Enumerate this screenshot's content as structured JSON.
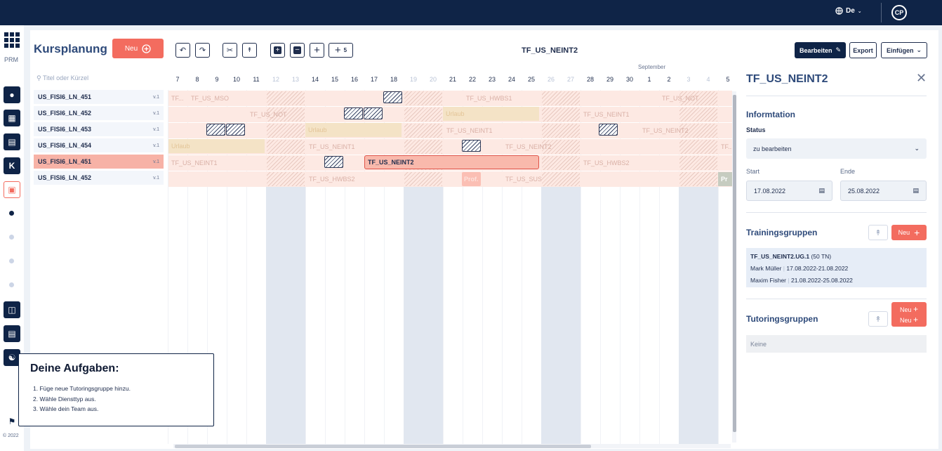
{
  "header": {
    "lang": "De",
    "avatar": "CP"
  },
  "rail": {
    "label": "PRM",
    "k": "K",
    "copyright": "© 2022"
  },
  "page": {
    "title": "Kursplanung",
    "new_button": "Neu",
    "search_placeholder": "Titel oder Kürzel"
  },
  "courses": [
    {
      "name": "US_FISI6_LN_451",
      "version": "v.1"
    },
    {
      "name": "US_FISI6_LN_452",
      "version": "v.1"
    },
    {
      "name": "US_FISI6_LN_453",
      "version": "v.1"
    },
    {
      "name": "US_FISI6_LN_454",
      "version": "v.1"
    },
    {
      "name": "US_FISI6_LN_451",
      "version": "v.1"
    },
    {
      "name": "US_FISI6_LN_452",
      "version": "v.1"
    }
  ],
  "toolbar": {
    "title": "TF_US_NEINT2",
    "zoom_count": "5",
    "edit": "Bearbeiten",
    "export": "Export",
    "insert": "Einfügen"
  },
  "calendar": {
    "month": "September",
    "days": [
      "7",
      "8",
      "9",
      "10",
      "11",
      "12",
      "13",
      "14",
      "15",
      "16",
      "17",
      "18",
      "19",
      "20",
      "21",
      "22",
      "23",
      "24",
      "25",
      "26",
      "27",
      "28",
      "29",
      "30",
      "1",
      "2",
      "3",
      "4",
      "5"
    ],
    "weekend_indices": [
      5,
      6,
      12,
      13,
      19,
      20,
      26,
      27
    ],
    "labels": {
      "r0a": "TF...",
      "r0b": "TF_US_MSO",
      "r0c": "TF_US_HWBS1",
      "r0d": "TF_US_NOT",
      "r1a": "TF_US_NOT",
      "r1b": "Urlaub",
      "r1c": "TF_US_NEINT1",
      "r2a": "Urlaub",
      "r2b": "TF_US_NEINT1",
      "r2c": "TF_US_NEINT2",
      "r3a": "Urlaub",
      "r3b": "TF_US_NEINT1",
      "r3c": "TF_US_NEINT2",
      "r3d": "TF...",
      "r4a": "TF_US_NEINT1",
      "r4b": "TF_US_NEINT2",
      "r4c": "TF_US_HWBS2",
      "r5a": "TF_US_HWBS2",
      "r5b": "Prof.",
      "r5c": "TF_US_SUS",
      "r5d": "Pr"
    }
  },
  "side": {
    "title": "TF_US_NEINT2",
    "info_heading": "Informtation",
    "status_label": "Status",
    "status_value": "zu bearbeiten",
    "start_label": "Start",
    "end_label": "Ende",
    "start_value": "17.08.2022",
    "end_value": "25.08.2022",
    "training_heading": "Trainingsgruppen",
    "new_label": "Neu",
    "group_name": "TF_US_NEINT2.UG.1",
    "group_count": "(50 TN)",
    "trainer1": "Mark Müller",
    "trainer1_dates": "17.08.2022-21.08.2022",
    "trainer2": "Maxim Fisher",
    "trainer2_dates": "21.08.2022-25.08.2022",
    "tutoring_heading": "Tutoringsgruppen",
    "none": "Keine"
  },
  "tasks": {
    "title": "Deine Aufgaben:",
    "items": [
      "1. Füge neue Tutoringsgruppe hinzu.",
      "2. Wähle Diensttyp aus.",
      "3. Wähle dein Team aus."
    ]
  },
  "colors": {
    "navy": "#0f2447",
    "accent": "#f36c5f",
    "row_bg": "#fde9e3",
    "urlaub": "#f4e3c6"
  }
}
